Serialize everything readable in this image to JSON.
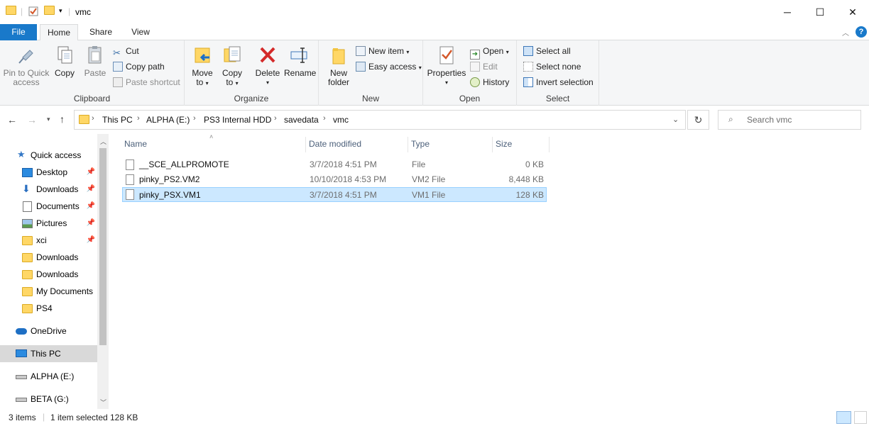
{
  "window": {
    "title": "vmc",
    "controls": {
      "minimize": "─",
      "maximize": "☐",
      "close": "✕"
    },
    "help": "?"
  },
  "tabs": [
    {
      "label": "File"
    },
    {
      "label": "Home"
    },
    {
      "label": "Share"
    },
    {
      "label": "View"
    }
  ],
  "ribbon": {
    "clipboard": {
      "label": "Clipboard",
      "pin_line1": "Pin to Quick",
      "pin_line2": "access",
      "copy": "Copy",
      "paste": "Paste",
      "cut": "Cut",
      "copy_path": "Copy path",
      "paste_shortcut": "Paste shortcut"
    },
    "organize": {
      "label": "Organize",
      "move_line1": "Move",
      "move_line2": "to",
      "copy_line1": "Copy",
      "copy_line2": "to",
      "delete": "Delete",
      "rename": "Rename"
    },
    "new": {
      "label": "New",
      "folder_line1": "New",
      "folder_line2": "folder",
      "new_item": "New item",
      "easy_access": "Easy access"
    },
    "open": {
      "label": "Open",
      "properties": "Properties",
      "open": "Open",
      "edit": "Edit",
      "history": "History"
    },
    "select": {
      "label": "Select",
      "select_all": "Select all",
      "select_none": "Select none",
      "invert": "Invert selection"
    }
  },
  "address": {
    "crumbs": [
      "This PC",
      "ALPHA (E:)",
      "PS3 Internal HDD",
      "savedata",
      "vmc"
    ],
    "search_placeholder": "Search vmc"
  },
  "nav": {
    "quick_access": "Quick access",
    "pinned": [
      "Desktop",
      "Downloads",
      "Documents",
      "Pictures",
      "xci"
    ],
    "folders": [
      "Downloads",
      "Downloads",
      "My Documents",
      "PS4"
    ],
    "onedrive": "OneDrive",
    "this_pc": "This PC",
    "drive_alpha": "ALPHA (E:)",
    "drive_beta": "BETA (G:)"
  },
  "columns": {
    "name": "Name",
    "date": "Date modified",
    "type": "Type",
    "size": "Size"
  },
  "files": [
    {
      "name": "__SCE_ALLPROMOTE",
      "date": "3/7/2018 4:51 PM",
      "type": "File",
      "size": "0 KB"
    },
    {
      "name": "pinky_PS2.VM2",
      "date": "10/10/2018 4:53 PM",
      "type": "VM2 File",
      "size": "8,448 KB"
    },
    {
      "name": "pinky_PSX.VM1",
      "date": "3/7/2018 4:51 PM",
      "type": "VM1 File",
      "size": "128 KB"
    }
  ],
  "status": {
    "items": "3 items",
    "selected": "1 item selected",
    "size": "128 KB"
  }
}
